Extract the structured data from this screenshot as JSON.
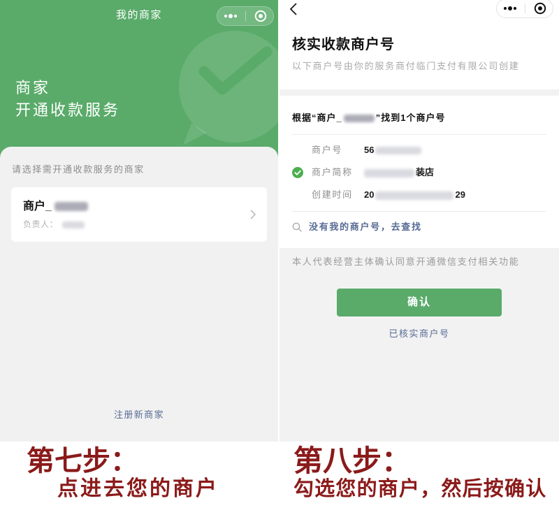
{
  "left_screen": {
    "nav_title": "我的商家",
    "header_line1": "商家",
    "header_line2": "开通收款服务",
    "prompt": "请选择需开通收款服务的商家",
    "merchant_card": {
      "name_prefix": "商户_",
      "owner_label": "负责人："
    },
    "register_link": "注册新商家"
  },
  "right_screen": {
    "title": "核实收款商户号",
    "subtitle": "以下商户号由你的服务商付临门支付有限公司创建",
    "found_before": "根据“商户_",
    "found_after": "”找到1个商户号",
    "merchant": {
      "selected": true,
      "id_label": "商户号",
      "id_value_visible": "56",
      "short_name_label": "商户简称",
      "short_name_visible": "装店",
      "created_label": "创建时间",
      "created_visible_start": "20",
      "created_visible_end": "29"
    },
    "search_link": "没有我的商户号，去查找",
    "consent_text": "本人代表经营主体确认同意开通微信支付相关功能",
    "confirm_button": "确认",
    "verified_link": "已核实商户号"
  },
  "captions": {
    "step7_title": "第七步：",
    "step7_text": "点进去您的商户",
    "step8_title": "第八步：",
    "step8_text": "勾选您的商户，然后按确认"
  },
  "colors": {
    "wechat_green": "#5aab6a",
    "check_green": "#4caf50",
    "link_blue": "#576b95",
    "caption_red": "#8b1a1a",
    "page_gray": "#f2f2f2"
  },
  "icons": {
    "more": "more-dots-icon",
    "mini_program_close": "target-icon",
    "back": "back-chevron-icon",
    "card_arrow": "chevron-right-icon",
    "selected": "check-circle-icon",
    "search": "search-icon",
    "header_watermark": "wechat-pay-logo-watermark"
  }
}
